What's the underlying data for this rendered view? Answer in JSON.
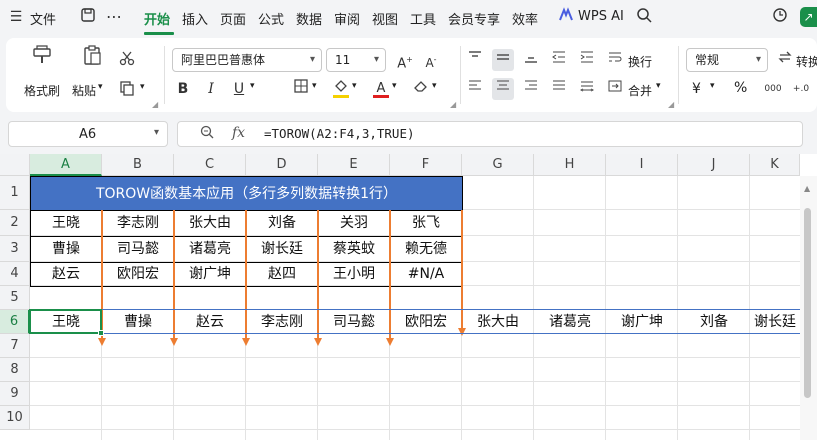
{
  "menu": {
    "hamburger": "☰",
    "file": "文件",
    "tabs": [
      "开始",
      "插入",
      "页面",
      "公式",
      "数据",
      "审阅",
      "视图",
      "工具",
      "会员专享",
      "效率"
    ],
    "active_tab": "开始",
    "wps_ai": "WPS AI"
  },
  "ribbon": {
    "format_painter": "格式刷",
    "paste": "粘贴",
    "font_name": "阿里巴巴普惠体",
    "font_size": "11",
    "wrap": "换行",
    "merge": "合并",
    "number_format": "常规",
    "convert": "转换",
    "currency": "¥",
    "percent": "%",
    "colors": {
      "fill": "#f5d100",
      "font": "#e02020",
      "accent": "#1a8f4a"
    }
  },
  "formula_bar": {
    "name_box": "A6",
    "fx": "fx",
    "formula": "=TOROW(A2:F4,3,TRUE)"
  },
  "sheet": {
    "columns": [
      "A",
      "B",
      "C",
      "D",
      "E",
      "F",
      "G",
      "H",
      "I",
      "J",
      "K"
    ],
    "rows": [
      "1",
      "2",
      "3",
      "4",
      "5",
      "6",
      "7",
      "8",
      "9",
      "10"
    ],
    "title": "TOROW函数基本应用（多行多列数据转换1行）",
    "data": [
      [
        "王晓",
        "李志刚",
        "张大由",
        "刘备",
        "关羽",
        "张飞"
      ],
      [
        "曹操",
        "司马懿",
        "诸葛亮",
        "谢长廷",
        "蔡英蚊",
        "赖无德"
      ],
      [
        "赵云",
        "欧阳宏",
        "谢广坤",
        "赵四",
        "王小明",
        "#N/A"
      ]
    ],
    "result": [
      "王晓",
      "曹操",
      "赵云",
      "李志刚",
      "司马懿",
      "欧阳宏",
      "张大由",
      "诸葛亮",
      "谢广坤",
      "刘备",
      "谢长廷"
    ],
    "arrow_color": "#ed7d31",
    "title_color": "#4472c4"
  }
}
